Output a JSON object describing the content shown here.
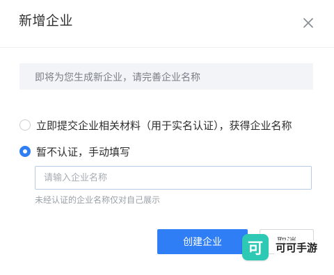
{
  "dialog": {
    "title": "新增企业",
    "close_icon": "close-icon"
  },
  "notice": {
    "text": "即将为您生成新企业，请完善企业名称"
  },
  "options": [
    {
      "label": "立即提交企业相关材料（用于实名认证），获得企业名称",
      "checked": false
    },
    {
      "label": "暂不认证，手动填写",
      "checked": true
    }
  ],
  "name_input": {
    "value": "",
    "placeholder": "请输入企业名称"
  },
  "hint": "未经认证的企业名称仅对自己展示",
  "actions": {
    "create_label": "创建企业",
    "cancel_label": "取消"
  },
  "watermark": {
    "logo_char": "可",
    "text": "可可手游"
  },
  "colors": {
    "accent": "#2f7ef5",
    "watermark_logo": "#2ec9b4"
  }
}
